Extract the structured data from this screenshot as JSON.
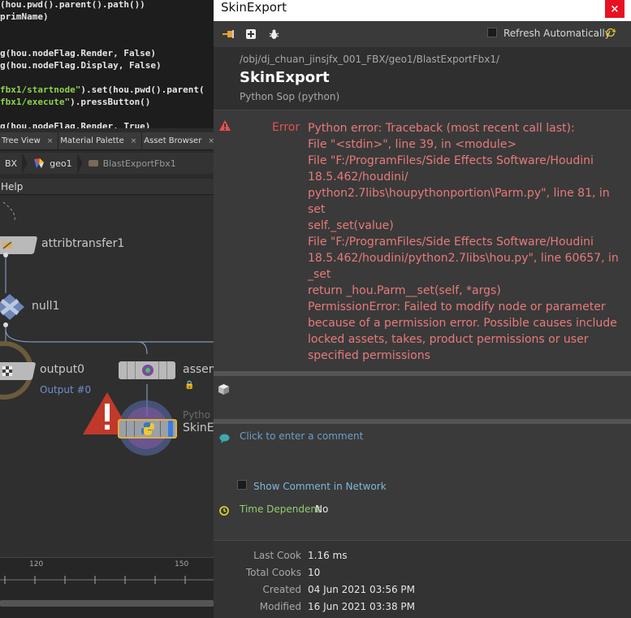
{
  "code": {
    "lines": [
      {
        "pre": "(hou.pwd().parent().path())",
        "str": "",
        "post": ""
      },
      {
        "pre": "primName)",
        "str": "",
        "post": ""
      },
      {
        "pre": "",
        "str": "",
        "post": ""
      },
      {
        "pre": "",
        "str": "",
        "post": ""
      },
      {
        "pre": "g(hou.nodeFlag.Render, False)",
        "str": "",
        "post": ""
      },
      {
        "pre": "g(hou.nodeFlag.Display, False)",
        "str": "",
        "post": ""
      },
      {
        "pre": "",
        "str": "",
        "post": ""
      },
      {
        "pre": "",
        "str": "fbx1/startnode\"",
        "post": ").set(hou.pwd().parent("
      },
      {
        "pre": "",
        "str": "fbx1/execute\"",
        "post": ").pressButton()"
      },
      {
        "pre": "",
        "str": "",
        "post": ""
      },
      {
        "pre": "g(hou.nodeFlag.Render, True)",
        "str": "",
        "post": ""
      }
    ]
  },
  "pane_tabs": [
    {
      "label": "Tree View"
    },
    {
      "label": "Material Palette"
    },
    {
      "label": "Asset Browser"
    }
  ],
  "breadcrumb": {
    "items": [
      {
        "label": "BX"
      },
      {
        "label": "geo1"
      },
      {
        "label": "BlastExportFbx1"
      }
    ]
  },
  "menu": {
    "help": "Help"
  },
  "network": {
    "nodes": {
      "attribtransfer": "attribtransfer1",
      "null": "null1",
      "output": "output0",
      "output_sub": "Output #0",
      "assemble": "assem",
      "python_type": "Pytho",
      "skin": "SkinE"
    }
  },
  "timeline": {
    "ticks": [
      "120",
      "150"
    ]
  },
  "window": {
    "title": "SkinExport",
    "close_label": "×"
  },
  "toolbar": {
    "refresh_label": "Refresh Automatically",
    "refresh_checked": false
  },
  "header": {
    "path": "/obj/dj_chuan_jinsjfx_001_FBX/geo1/BlastExportFbx1/",
    "name": "SkinExport",
    "type": "Python Sop (python)"
  },
  "error": {
    "label": "Error",
    "lines": [
      "Python error: Traceback (most recent call last):",
      "File \"<stdin>\", line 39, in <module>",
      "File \"F:/ProgramFiles/Side Effects Software/Houdini 18.5.462/houdini/ python2.7libs\\houpythonportion\\Parm.py\", line 81, in set",
      "self._set(value)",
      "File \"F:/ProgramFiles/Side Effects Software/Houdini 18.5.462/houdini/python2.7libs\\hou.py\", line 60657, in _set",
      "return _hou.Parm__set(self, *args)",
      "PermissionError: Failed to modify node or parameter because of a permission error. Possible causes include locked assets, takes, product permissions or user specified permissions"
    ]
  },
  "comment": {
    "placeholder": "Click to enter a comment",
    "show_label": "Show Comment in Network",
    "show_checked": false
  },
  "time_dependent": {
    "label": "Time Dependent",
    "value": "No"
  },
  "stats": [
    {
      "label": "Last Cook",
      "value": "1.16 ms"
    },
    {
      "label": "Total Cooks",
      "value": "10"
    },
    {
      "label": "Created",
      "value": "04 Jun 2021 03:56 PM"
    },
    {
      "label": "Modified",
      "value": "16 Jun 2021 03:38 PM"
    }
  ],
  "colors": {
    "error_text": "#e87a7a",
    "error_label": "#e84f4f",
    "close_button": "#e81123",
    "refresh_icon": "#e0c020",
    "time_dependent_label": "#8fcf6f",
    "comment_placeholder": "#6c9fc8"
  },
  "icons": {
    "toolbar": [
      "pin-icon",
      "add-icon",
      "bug-icon",
      "refresh-icon"
    ],
    "sections": [
      "warning-icon",
      "cube-icon",
      "comment-icon",
      "clock-icon"
    ]
  }
}
